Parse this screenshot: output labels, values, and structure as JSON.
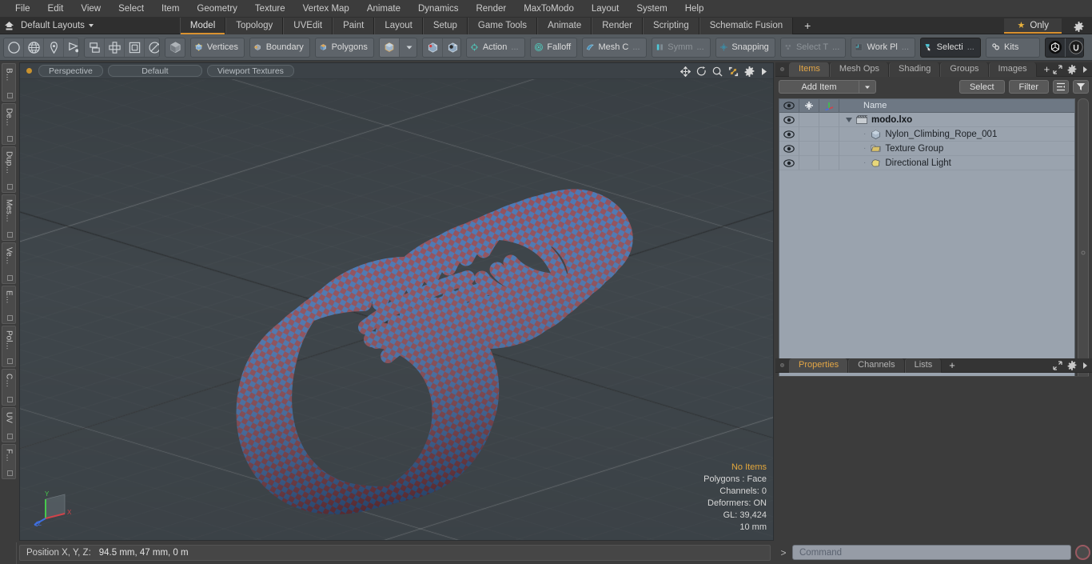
{
  "app": {
    "title": "Modo",
    "document": "modo.lxo"
  },
  "menubar": {
    "items": [
      {
        "label": "File"
      },
      {
        "label": "Edit"
      },
      {
        "label": "View"
      },
      {
        "label": "Select"
      },
      {
        "label": "Item"
      },
      {
        "label": "Geometry"
      },
      {
        "label": "Texture"
      },
      {
        "label": "Vertex Map"
      },
      {
        "label": "Animate"
      },
      {
        "label": "Dynamics"
      },
      {
        "label": "Render"
      },
      {
        "label": "MaxToModo"
      },
      {
        "label": "Layout"
      },
      {
        "label": "System"
      },
      {
        "label": "Help"
      }
    ]
  },
  "layoutbar": {
    "home_icon": "home-icon",
    "layout_name": "Default Layouts",
    "tabs": [
      {
        "label": "Model",
        "active": true
      },
      {
        "label": "Topology",
        "active": false
      },
      {
        "label": "UVEdit",
        "active": false
      },
      {
        "label": "Paint",
        "active": false
      },
      {
        "label": "Layout",
        "active": false
      },
      {
        "label": "Setup",
        "active": false
      },
      {
        "label": "Game Tools",
        "active": false
      },
      {
        "label": "Animate",
        "active": false
      },
      {
        "label": "Render",
        "active": false
      },
      {
        "label": "Scripting",
        "active": false
      },
      {
        "label": "Schematic Fusion",
        "active": false
      }
    ],
    "add_tab": "+",
    "only_label": "Only",
    "only_icon": "star-icon",
    "settings_icon": "gear-icon",
    "accent": "#d9912f"
  },
  "toolbar": {
    "groups": [
      {
        "buttons": [
          {
            "name": "circle-tool-icon",
            "label": ""
          },
          {
            "name": "globe-tool-icon",
            "label": ""
          },
          {
            "name": "pen-tool-icon",
            "label": ""
          },
          {
            "name": "polygon-pen-icon",
            "label": ""
          }
        ]
      },
      {
        "buttons": [
          {
            "name": "mirror-tool-icon",
            "label": ""
          },
          {
            "name": "array-tool-icon",
            "label": ""
          },
          {
            "name": "bevel-tool-icon",
            "label": ""
          },
          {
            "name": "radial-tool-icon",
            "label": ""
          }
        ]
      },
      {
        "buttons": [
          {
            "name": "cube-shaded-icon",
            "label": ""
          }
        ]
      },
      {
        "buttons": [
          {
            "name": "vertices-icon",
            "label": "Vertices"
          }
        ]
      },
      {
        "buttons": [
          {
            "name": "boundary-icon",
            "label": "Boundary"
          }
        ]
      },
      {
        "buttons": [
          {
            "name": "polygons-icon",
            "label": "Polygons"
          }
        ]
      },
      {
        "buttons": [
          {
            "name": "item-mode-icon",
            "label": ""
          },
          {
            "name": "mode-dropdown-icon",
            "label": ""
          }
        ]
      },
      {
        "buttons": [
          {
            "name": "center-icon",
            "label": ""
          },
          {
            "name": "pivot-icon",
            "label": ""
          }
        ]
      },
      {
        "buttons": [
          {
            "name": "action-center-icon",
            "label": "Action",
            "suffix": "..."
          }
        ]
      },
      {
        "buttons": [
          {
            "name": "falloff-icon",
            "label": "Falloff"
          }
        ]
      },
      {
        "buttons": [
          {
            "name": "mesh-constraint-icon",
            "label": "Mesh C",
            "suffix": "..."
          }
        ]
      },
      {
        "buttons": [
          {
            "name": "symmetry-icon",
            "label": "Symm",
            "suffix": "..."
          }
        ]
      },
      {
        "buttons": [
          {
            "name": "snapping-icon",
            "label": "Snapping"
          }
        ]
      },
      {
        "buttons": [
          {
            "name": "select-through-icon",
            "label": "Select T",
            "suffix": "...",
            "disabled": true
          }
        ]
      },
      {
        "buttons": [
          {
            "name": "work-plane-icon",
            "label": "Work Pl",
            "suffix": "..."
          }
        ]
      },
      {
        "buttons": [
          {
            "name": "selection-set-icon",
            "label": "Selecti",
            "suffix": "..."
          }
        ]
      },
      {
        "buttons": [
          {
            "name": "kits-icon",
            "label": "Kits"
          }
        ]
      },
      {
        "buttons": [
          {
            "name": "unity-export-icon",
            "label": ""
          },
          {
            "name": "unreal-export-icon",
            "label": ""
          }
        ]
      }
    ]
  },
  "left_tabs": {
    "items": [
      {
        "label": "B…"
      },
      {
        "label": "De…"
      },
      {
        "label": "Dup…"
      },
      {
        "label": "Mes…"
      },
      {
        "label": "Ve…"
      },
      {
        "label": "E…"
      },
      {
        "label": "Pol…"
      },
      {
        "label": "C…"
      },
      {
        "label": "UV"
      },
      {
        "label": "F…"
      }
    ]
  },
  "viewport": {
    "header": {
      "view_mode": "Perspective",
      "preset": "Default",
      "shading": "Viewport Textures",
      "controls": [
        {
          "name": "pan-icon"
        },
        {
          "name": "rotate-icon"
        },
        {
          "name": "zoom-icon"
        },
        {
          "name": "fit-icon"
        },
        {
          "name": "viewport-settings-icon"
        },
        {
          "name": "viewport-menu-icon"
        }
      ]
    },
    "stats": {
      "selection": "No Items",
      "polygons": "Polygons : Face",
      "channels": "Channels: 0",
      "deformers": "Deformers: ON",
      "gl": "GL: 39,424",
      "grid_size": "10 mm"
    },
    "axis": {
      "x": "X",
      "y": "Y",
      "z": "Z"
    },
    "background_color": "#3f464b",
    "rope_blue": "#3f6fb0",
    "rope_red": "#8c4450"
  },
  "right_panel": {
    "tabs": [
      {
        "label": "Items",
        "active": true
      },
      {
        "label": "Mesh Ops",
        "active": false
      },
      {
        "label": "Shading",
        "active": false
      },
      {
        "label": "Groups",
        "active": false
      },
      {
        "label": "Images",
        "active": false
      }
    ],
    "add_tab": "+",
    "toolbar": {
      "add_item": "Add Item",
      "add_item_dropdown": "chevron-down-icon",
      "select": "Select",
      "filter": "Filter",
      "list_icon": "list-options-icon",
      "funnel_icon": "funnel-icon"
    },
    "tree": {
      "columns": [
        {
          "name": "visibility-icon"
        },
        {
          "name": "lock-icon"
        },
        {
          "name": "axis-icon"
        },
        {
          "label": "Name"
        }
      ],
      "rows": [
        {
          "label": "modo.lxo",
          "icon": "scene-icon",
          "depth": 0,
          "expanded": true
        },
        {
          "label": "Nylon_Climbing_Rope_001",
          "icon": "mesh-icon",
          "depth": 1
        },
        {
          "label": "Texture Group",
          "icon": "group-icon",
          "depth": 1
        },
        {
          "label": "Directional Light",
          "icon": "light-icon",
          "depth": 1
        }
      ]
    },
    "properties_tabs": [
      {
        "label": "Properties",
        "active": true
      },
      {
        "label": "Channels",
        "active": false
      },
      {
        "label": "Lists",
        "active": false
      }
    ],
    "properties_add_tab": "+"
  },
  "statusbar": {
    "position_label": "Position X, Y, Z:",
    "position_value": "94.5 mm, 47 mm, 0 m",
    "command_placeholder": "Command",
    "command_value": "",
    "command_prompt": ">",
    "record_icon": "record-icon"
  }
}
